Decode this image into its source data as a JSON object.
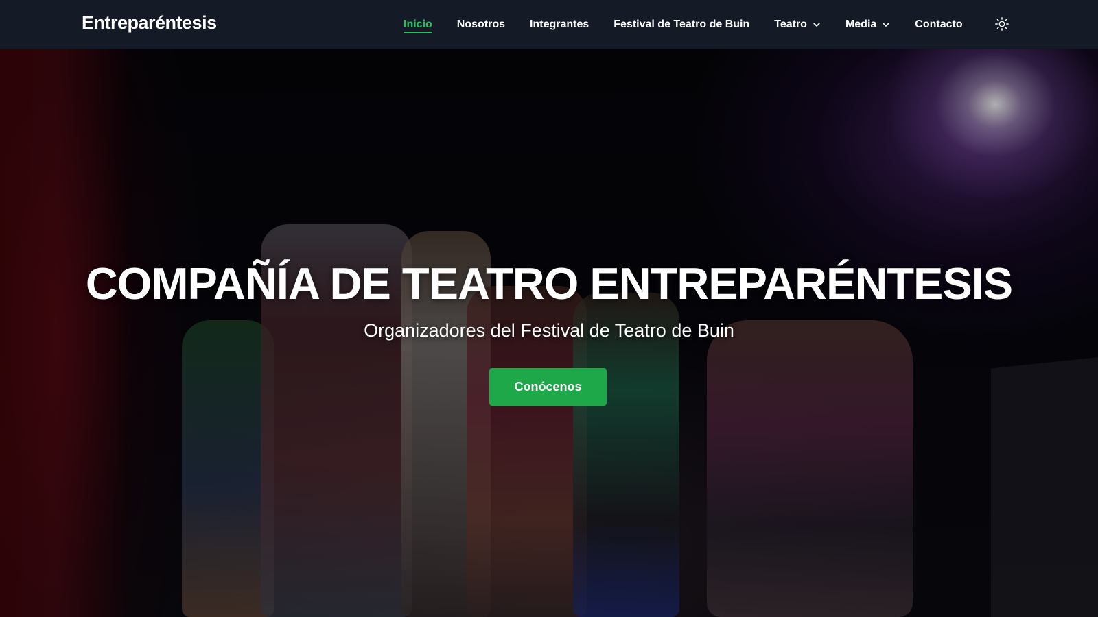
{
  "brand": {
    "name": "Entreparéntesis"
  },
  "nav": {
    "items": [
      {
        "label": "Inicio",
        "active": true
      },
      {
        "label": "Nosotros"
      },
      {
        "label": "Integrantes"
      },
      {
        "label": "Festival de Teatro de Buin"
      },
      {
        "label": "Teatro",
        "dropdown": true
      },
      {
        "label": "Media",
        "dropdown": true
      },
      {
        "label": "Contacto"
      }
    ],
    "theme_toggle_icon": "sun-icon"
  },
  "hero": {
    "title": "COMPAÑÍA DE TEATRO ENTREPARÉNTESIS",
    "subtitle": "Organizadores del Festival de Teatro de Buin",
    "cta_label": "Conócenos"
  },
  "colors": {
    "navbar_bg": "#151b26",
    "accent_active": "#22c55e",
    "cta_bg": "#1ea84a"
  }
}
